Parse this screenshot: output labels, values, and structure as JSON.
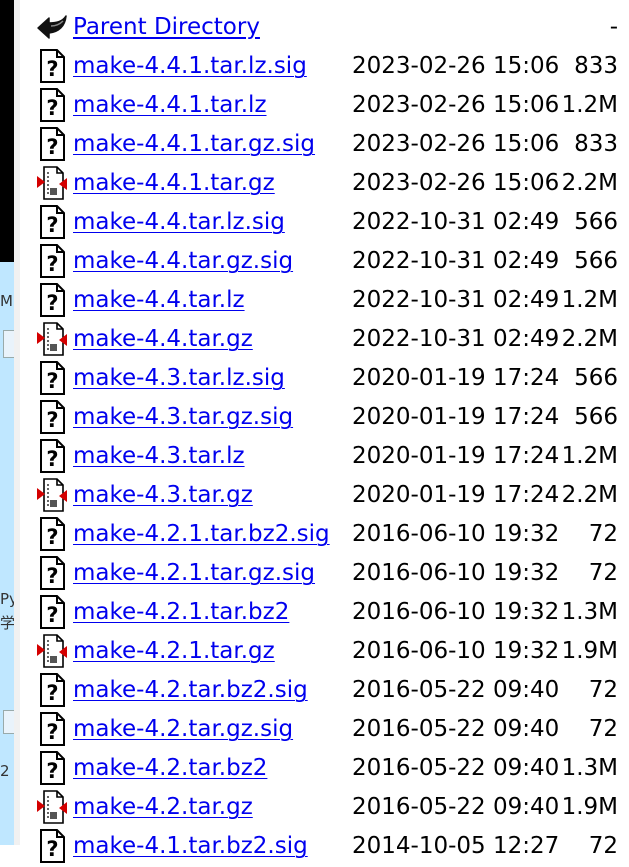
{
  "desktop_fragments": [
    "M",
    "Py",
    "学",
    "2"
  ],
  "listing": {
    "parent": {
      "label": "Parent Directory",
      "size": "-"
    },
    "files": [
      {
        "name": "make-4.4.1.tar.lz.sig",
        "date": "2023-02-26 15:06",
        "size": "833",
        "icon": "unknown-file-icon"
      },
      {
        "name": "make-4.4.1.tar.lz",
        "date": "2023-02-26 15:06",
        "size": "1.2M",
        "icon": "unknown-file-icon"
      },
      {
        "name": "make-4.4.1.tar.gz.sig",
        "date": "2023-02-26 15:06",
        "size": "833",
        "icon": "unknown-file-icon"
      },
      {
        "name": "make-4.4.1.tar.gz",
        "date": "2023-02-26 15:06",
        "size": "2.2M",
        "icon": "compressed-file-icon"
      },
      {
        "name": "make-4.4.tar.lz.sig",
        "date": "2022-10-31 02:49",
        "size": "566",
        "icon": "unknown-file-icon"
      },
      {
        "name": "make-4.4.tar.gz.sig",
        "date": "2022-10-31 02:49",
        "size": "566",
        "icon": "unknown-file-icon"
      },
      {
        "name": "make-4.4.tar.lz",
        "date": "2022-10-31 02:49",
        "size": "1.2M",
        "icon": "unknown-file-icon"
      },
      {
        "name": "make-4.4.tar.gz",
        "date": "2022-10-31 02:49",
        "size": "2.2M",
        "icon": "compressed-file-icon"
      },
      {
        "name": "make-4.3.tar.lz.sig",
        "date": "2020-01-19 17:24",
        "size": "566",
        "icon": "unknown-file-icon"
      },
      {
        "name": "make-4.3.tar.gz.sig",
        "date": "2020-01-19 17:24",
        "size": "566",
        "icon": "unknown-file-icon"
      },
      {
        "name": "make-4.3.tar.lz",
        "date": "2020-01-19 17:24",
        "size": "1.2M",
        "icon": "unknown-file-icon"
      },
      {
        "name": "make-4.3.tar.gz",
        "date": "2020-01-19 17:24",
        "size": "2.2M",
        "icon": "compressed-file-icon"
      },
      {
        "name": "make-4.2.1.tar.bz2.sig",
        "date": "2016-06-10 19:32",
        "size": "72",
        "icon": "unknown-file-icon"
      },
      {
        "name": "make-4.2.1.tar.gz.sig",
        "date": "2016-06-10 19:32",
        "size": "72",
        "icon": "unknown-file-icon"
      },
      {
        "name": "make-4.2.1.tar.bz2",
        "date": "2016-06-10 19:32",
        "size": "1.3M",
        "icon": "unknown-file-icon"
      },
      {
        "name": "make-4.2.1.tar.gz",
        "date": "2016-06-10 19:32",
        "size": "1.9M",
        "icon": "compressed-file-icon"
      },
      {
        "name": "make-4.2.tar.bz2.sig",
        "date": "2016-05-22 09:40",
        "size": "72",
        "icon": "unknown-file-icon"
      },
      {
        "name": "make-4.2.tar.gz.sig",
        "date": "2016-05-22 09:40",
        "size": "72",
        "icon": "unknown-file-icon"
      },
      {
        "name": "make-4.2.tar.bz2",
        "date": "2016-05-22 09:40",
        "size": "1.3M",
        "icon": "unknown-file-icon"
      },
      {
        "name": "make-4.2.tar.gz",
        "date": "2016-05-22 09:40",
        "size": "1.9M",
        "icon": "compressed-file-icon"
      },
      {
        "name": "make-4.1.tar.bz2.sig",
        "date": "2014-10-05 12:27",
        "size": "72",
        "icon": "unknown-file-icon"
      }
    ]
  },
  "colors": {
    "link": "#0000ee",
    "text": "#000000",
    "background": "#ffffff"
  }
}
